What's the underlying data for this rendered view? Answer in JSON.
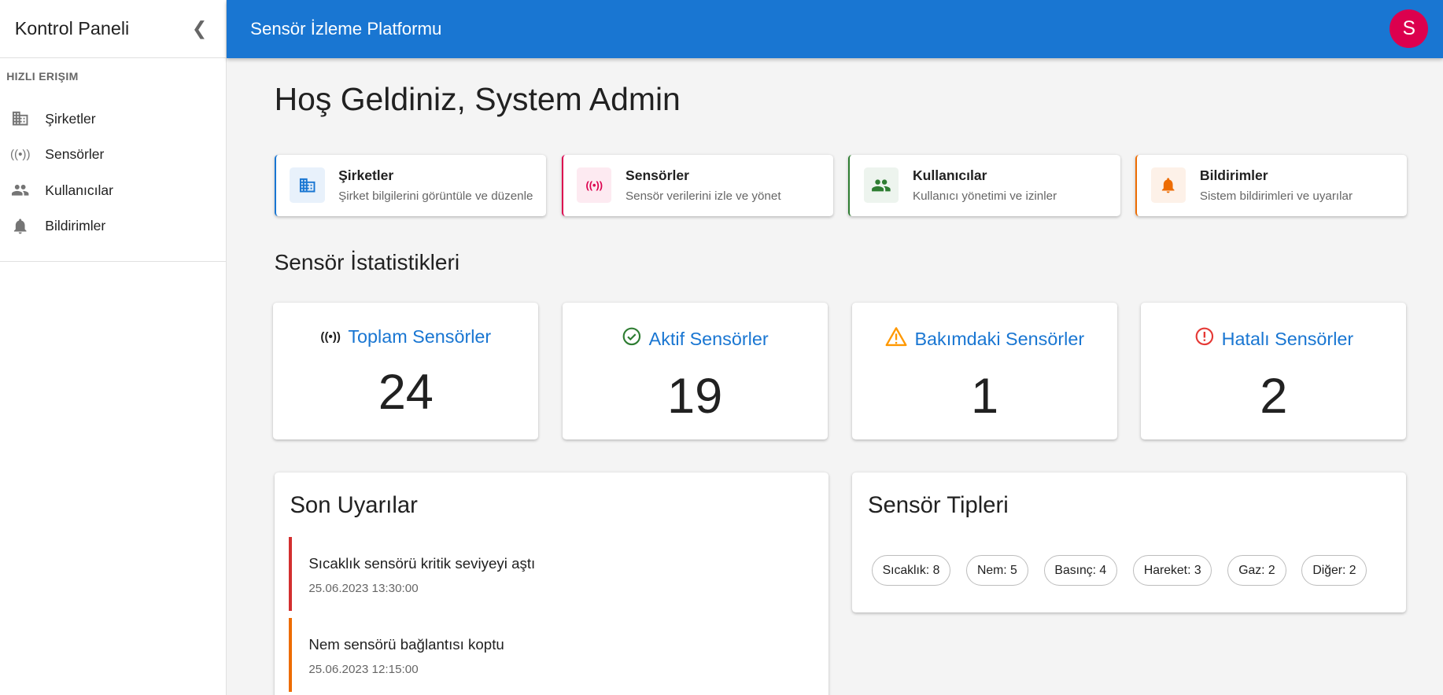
{
  "sidebar": {
    "title": "Kontrol Paneli",
    "section": "HIZLI ERIŞIM",
    "items": [
      {
        "label": "Şirketler",
        "icon": "building-icon"
      },
      {
        "label": "Sensörler",
        "icon": "sensor-icon"
      },
      {
        "label": "Kullanıcılar",
        "icon": "people-icon"
      },
      {
        "label": "Bildirimler",
        "icon": "bell-icon"
      }
    ]
  },
  "appbar": {
    "title": "Sensör İzleme Platformu",
    "avatar": "S",
    "color": "#1976d2"
  },
  "welcome": "Hoş Geldiniz, System Admin",
  "quick": [
    {
      "title": "Şirketler",
      "desc": "Şirket bilgilerini görüntüle ve düzenle",
      "color": "#1976d2"
    },
    {
      "title": "Sensörler",
      "desc": "Sensör verilerini izle ve yönet",
      "color": "#dc004e"
    },
    {
      "title": "Kullanıcılar",
      "desc": "Kullanıcı yönetimi ve izinler",
      "color": "#2e7d32"
    },
    {
      "title": "Bildirimler",
      "desc": "Sistem bildirimleri ve uyarılar",
      "color": "#ed6c02"
    }
  ],
  "stats_title": "Sensör İstatistikleri",
  "stats": [
    {
      "label": "Toplam Sensörler",
      "value": "24"
    },
    {
      "label": "Aktif Sensörler",
      "value": "19"
    },
    {
      "label": "Bakımdaki Sensörler",
      "value": "1"
    },
    {
      "label": "Hatalı Sensörler",
      "value": "2"
    }
  ],
  "alerts": {
    "title": "Son Uyarılar",
    "items": [
      {
        "text": "Sıcaklık sensörü kritik seviyeyi aştı",
        "date": "25.06.2023 13:30:00",
        "color": "#d32f2f"
      },
      {
        "text": "Nem sensörü bağlantısı koptu",
        "date": "25.06.2023 12:15:00",
        "color": "#ed6c02"
      }
    ]
  },
  "types": {
    "title": "Sensör Tipleri",
    "chips": [
      "Sıcaklık: 8",
      "Nem: 5",
      "Basınç: 4",
      "Hareket: 3",
      "Gaz: 2",
      "Diğer: 2"
    ]
  }
}
